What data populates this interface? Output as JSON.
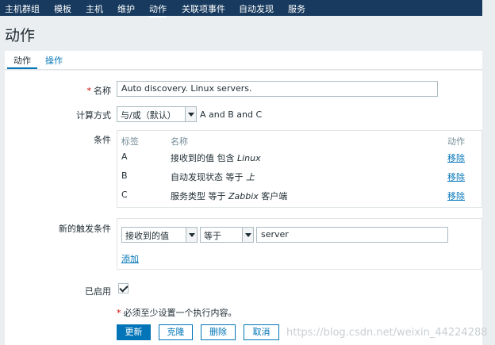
{
  "topnav": {
    "items": [
      "主机群组",
      "模板",
      "主机",
      "维护",
      "动作",
      "关联项事件",
      "自动发现",
      "服务"
    ],
    "active_index": 4
  },
  "page": {
    "title": "动作"
  },
  "tabs": [
    "动作",
    "操作"
  ],
  "form": {
    "name_label": "名称",
    "name_value": "Auto discovery. Linux servers.",
    "calc_label": "计算方式",
    "calc_value": "与/或（默认）",
    "calc_formula": "A and B and C",
    "conditions_label": "条件",
    "conditions_headers": {
      "tag": "标签",
      "name": "名称",
      "action": "动作"
    },
    "conditions": [
      {
        "tag": "A",
        "name_prefix": "接收到的值 包含 ",
        "name_em": "Linux",
        "name_suffix": "",
        "action": "移除"
      },
      {
        "tag": "B",
        "name_prefix": "自动发现状态 等于 ",
        "name_em": "上",
        "name_suffix": "",
        "action": "移除"
      },
      {
        "tag": "C",
        "name_prefix": "服务类型 等于 ",
        "name_em": "Zabbix",
        "name_suffix": " 客户端",
        "action": "移除"
      }
    ],
    "new_condition_label": "新的触发条件",
    "new_condition_type": "接收到的值",
    "new_condition_operator": "等于",
    "new_condition_value": "server",
    "add_link": "添加",
    "enabled_label": "已启用",
    "enabled": true,
    "note": "必须至少设置一个执行内容。",
    "buttons": {
      "update": "更新",
      "clone": "克隆",
      "delete": "删除",
      "cancel": "取消"
    }
  },
  "watermark": "https://blog.csdn.net/weixin_44224288",
  "colors": {
    "nav_bg": "#173a5e",
    "accent": "#0275b8",
    "required": "#d40000"
  }
}
